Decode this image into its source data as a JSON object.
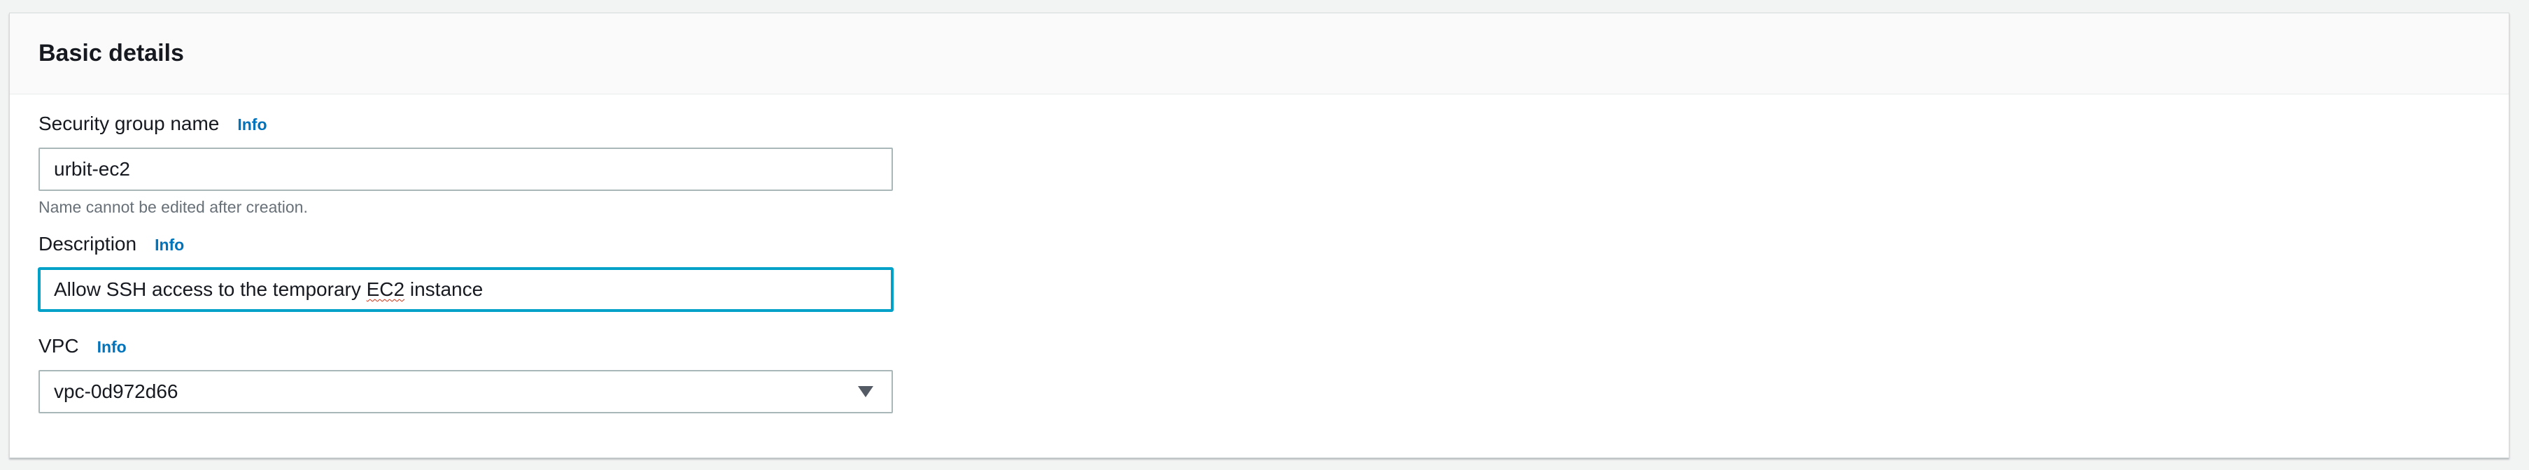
{
  "panel": {
    "title": "Basic details"
  },
  "fields": {
    "security_group_name": {
      "label": "Security group name",
      "info": "Info",
      "value": "urbit-ec2",
      "hint": "Name cannot be edited after creation."
    },
    "description": {
      "label": "Description",
      "info": "Info",
      "value_prefix": "Allow SSH access to the temporary ",
      "value_flagged": "EC2",
      "value_suffix": " instance"
    },
    "vpc": {
      "label": "VPC",
      "info": "Info",
      "selected": "vpc-0d972d66"
    }
  },
  "icons": {
    "vpc_dropdown": "caret-down-icon"
  },
  "colors": {
    "link": "#0073bb",
    "focus_border": "#00a1c9",
    "spellcheck": "#d13212"
  }
}
